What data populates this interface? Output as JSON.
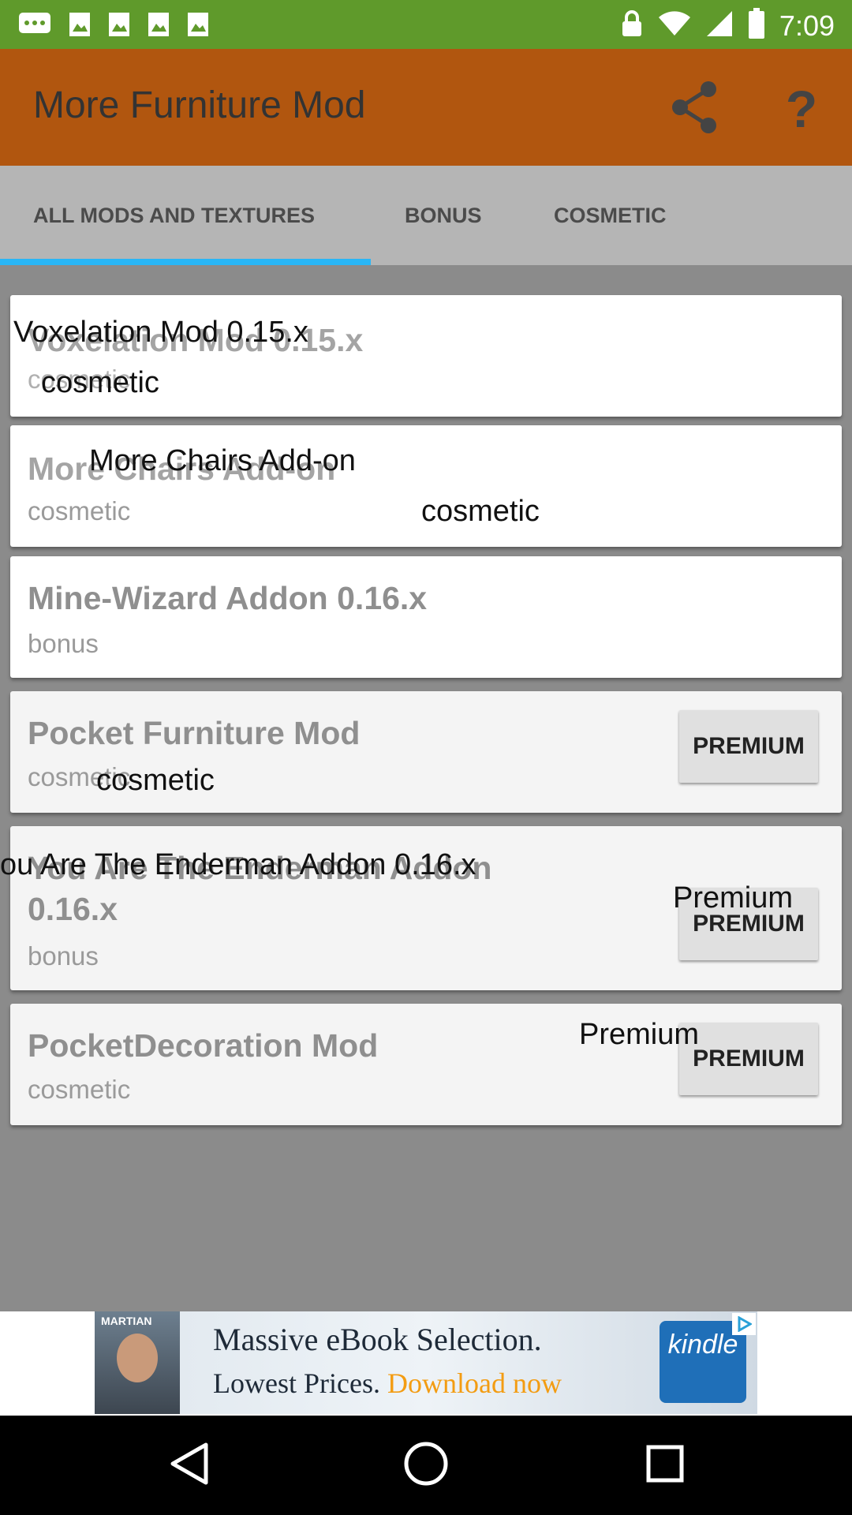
{
  "status_bar": {
    "time": "7:09",
    "icons": [
      "message-icon",
      "image-icon",
      "image-icon",
      "image-icon",
      "image-icon",
      "lock-icon",
      "wifi-icon",
      "cellular-icon",
      "battery-icon"
    ]
  },
  "app_bar": {
    "title": "More Furniture Mod",
    "actions": [
      "share-icon",
      "help-icon"
    ],
    "help_glyph": "?"
  },
  "tabs": [
    {
      "label": "ALL MODS AND TEXTURES",
      "selected": true
    },
    {
      "label": "BONUS",
      "selected": false
    },
    {
      "label": "COSMETIC",
      "selected": false
    }
  ],
  "mods": [
    {
      "title": "Voxelation Mod 0.15.x",
      "category": "cosmetic",
      "overlay_title": "Voxelation Mod 0.15.x",
      "overlay_category": "cosmetic"
    },
    {
      "title": "More Chairs Add-on",
      "category": "cosmetic",
      "overlay_title": "More Chairs Add-on",
      "overlay_category": "cosmetic"
    },
    {
      "title": "Mine-Wizard Addon 0.16.x",
      "category": "bonus"
    },
    {
      "title": "Pocket Furniture Mod",
      "category": "cosmetic",
      "overlay_category": "cosmetic",
      "button": "PREMIUM"
    },
    {
      "title_line1": "You Are The Enderman Addon",
      "title_line2": "0.16.x",
      "category": "bonus",
      "overlay_title": "ou Are The Enderman Addon 0.16.x",
      "overlay_premium": "Premium",
      "button": "PREMIUM"
    },
    {
      "title": "PocketDecoration Mod",
      "category": "cosmetic",
      "overlay_premium": "Premium",
      "button": "PREMIUM"
    }
  ],
  "ad": {
    "line1": "Massive eBook Selection.",
    "line2_prefix": "Lowest Prices.",
    "line2_cta": "Download now",
    "brand": "kindle",
    "poster_text": "MARTIAN"
  },
  "colors": {
    "status_bar": "#5f9a2b",
    "app_bar": "#b1560f",
    "tab_indicator": "#29b6f6",
    "list_background": "#8b8b8b"
  }
}
